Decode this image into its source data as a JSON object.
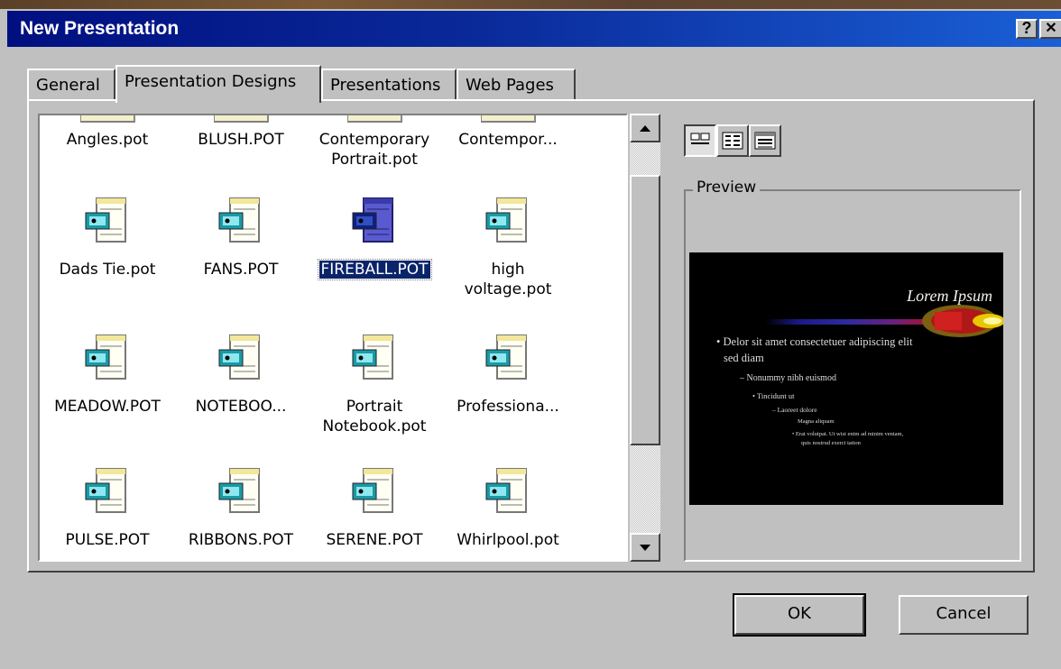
{
  "window": {
    "title": "New Presentation",
    "help_glyph": "?",
    "close_glyph": "✕"
  },
  "tabs": [
    "General",
    "Presentation Designs",
    "Presentations",
    "Web Pages"
  ],
  "active_tab": "Presentation Designs",
  "files": [
    {
      "label": [
        "Angles.pot"
      ],
      "selected": false
    },
    {
      "label": [
        "BLUSH.POT"
      ],
      "selected": false
    },
    {
      "label": [
        "Contemporary",
        "Portrait.pot"
      ],
      "selected": false
    },
    {
      "label": [
        "Contempor..."
      ],
      "selected": false
    },
    {
      "label": [
        "Dads Tie.pot"
      ],
      "selected": false
    },
    {
      "label": [
        "FANS.POT"
      ],
      "selected": false
    },
    {
      "label": [
        "FIREBALL.POT"
      ],
      "selected": true
    },
    {
      "label": [
        "high",
        "voltage.pot"
      ],
      "selected": false
    },
    {
      "label": [
        "MEADOW.POT"
      ],
      "selected": false
    },
    {
      "label": [
        "NOTEBOO..."
      ],
      "selected": false
    },
    {
      "label": [
        "Portrait",
        "Notebook.pot"
      ],
      "selected": false
    },
    {
      "label": [
        "Professiona..."
      ],
      "selected": false
    },
    {
      "label": [
        "PULSE.POT"
      ],
      "selected": false
    },
    {
      "label": [
        "RIBBONS.POT"
      ],
      "selected": false
    },
    {
      "label": [
        "SERENE.POT"
      ],
      "selected": false
    },
    {
      "label": [
        "Whirlpool.pot"
      ],
      "selected": false
    }
  ],
  "view_buttons": [
    "large-icons",
    "list",
    "details"
  ],
  "preview": {
    "legend": "Preview",
    "slide_title": "Lorem Ipsum",
    "bullets": [
      "• Delor sit amet consectetuer adipiscing elit",
      "sed diam",
      "– Nonummy nibh euismod",
      "• Tincidunt ut",
      "– Laoreet dolore",
      "Magna aliquam",
      "• Erat volutpat. Ut wisi enim ad minim veniam,",
      "quis nostrud exerci tation"
    ]
  },
  "buttons": {
    "ok": "OK",
    "cancel": "Cancel"
  },
  "colors": {
    "titlebar_start": "#000f80",
    "titlebar_end": "#1a5fd6",
    "face": "#c0c0c0",
    "selection": "#0a246a"
  }
}
